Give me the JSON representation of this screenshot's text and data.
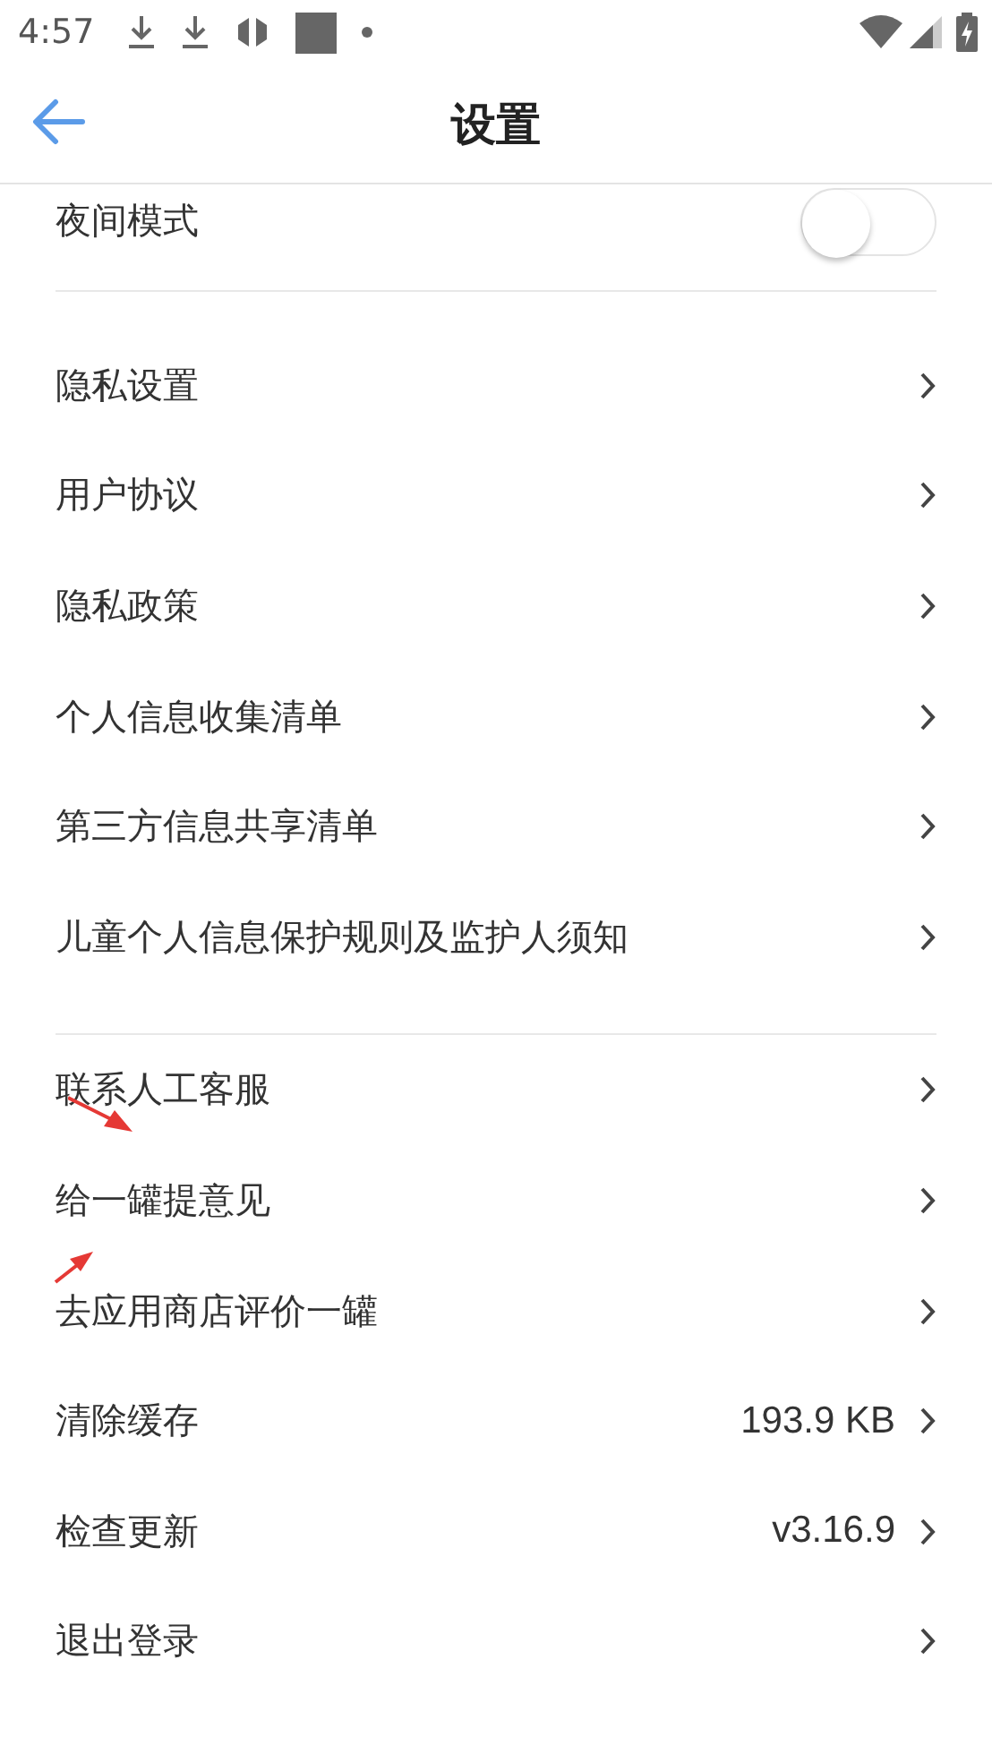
{
  "status_bar": {
    "time": "4:57"
  },
  "header": {
    "title": "设置"
  },
  "sections": [
    {
      "items": [
        {
          "kind": "toggle",
          "label": "夜间模式",
          "on": false
        }
      ]
    },
    {
      "items": [
        {
          "kind": "link",
          "label": "隐私设置"
        },
        {
          "kind": "link",
          "label": "用户协议"
        },
        {
          "kind": "link",
          "label": "隐私政策"
        },
        {
          "kind": "link",
          "label": "个人信息收集清单"
        },
        {
          "kind": "link",
          "label": "第三方信息共享清单"
        },
        {
          "kind": "link",
          "label": "儿童个人信息保护规则及监护人须知"
        }
      ]
    },
    {
      "items": [
        {
          "kind": "link",
          "label": "联系人工客服"
        },
        {
          "kind": "link",
          "label": "给一罐提意见"
        },
        {
          "kind": "link",
          "label": "去应用商店评价一罐"
        },
        {
          "kind": "link",
          "label": "清除缓存",
          "value": "193.9 KB"
        },
        {
          "kind": "link",
          "label": "检查更新",
          "value": "v3.16.9"
        },
        {
          "kind": "link",
          "label": "退出登录"
        }
      ]
    }
  ]
}
